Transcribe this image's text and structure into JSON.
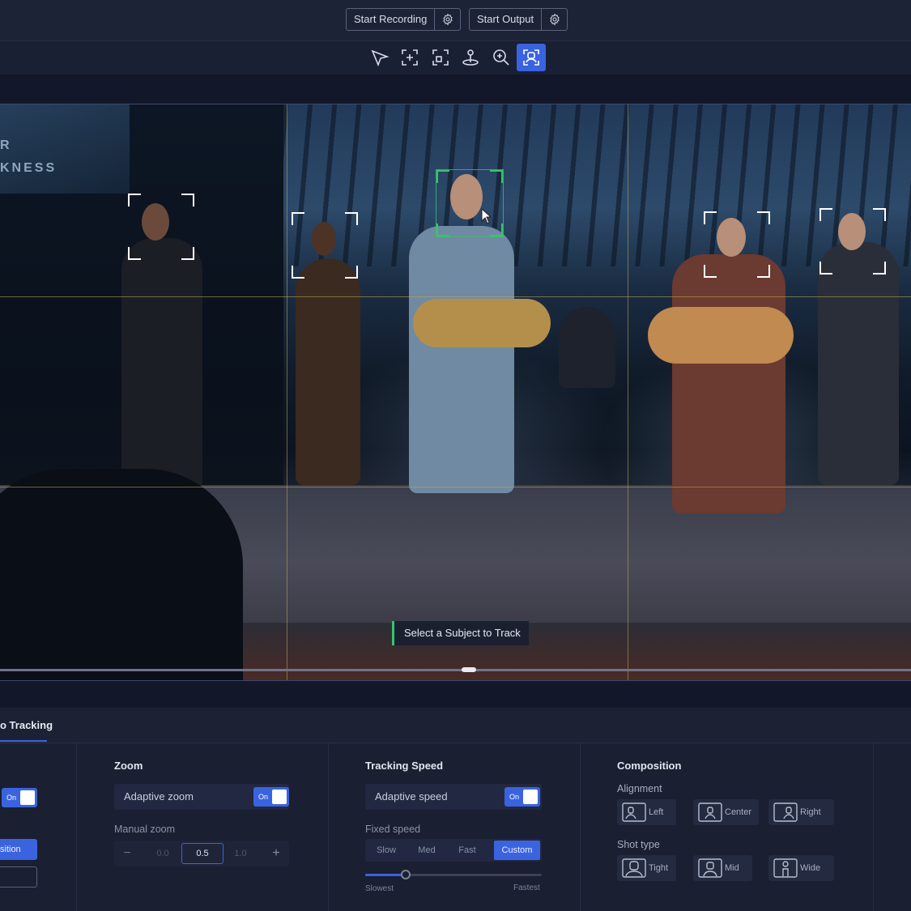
{
  "topbar": {
    "start_recording": "Start Recording",
    "start_output": "Start Output",
    "icons": [
      "gear-icon",
      "gear-icon"
    ]
  },
  "toolbar": {
    "tools": [
      "pointer-tool",
      "add-region-tool",
      "crop-tool",
      "position-pin-tool",
      "zoom-tool",
      "face-tracking-tool"
    ],
    "active_tool": "face-tracking-tool"
  },
  "video": {
    "screen_text_line1": "R",
    "screen_text_line2": "KNESS",
    "tooltip": "Select a Subject to Track"
  },
  "panel": {
    "tab_label": "o Tracking",
    "left_toggle_on": "On",
    "left_button_label": "sition",
    "zoom": {
      "title": "Zoom",
      "adaptive_label": "Adaptive zoom",
      "toggle_on": "On",
      "manual_label": "Manual zoom",
      "minus": "−",
      "plus": "+",
      "val_prev": "0.0",
      "val_current": "0.5",
      "val_next": "1.0"
    },
    "speed": {
      "title": "Tracking Speed",
      "adaptive_label": "Adaptive speed",
      "toggle_on": "On",
      "fixed_label": "Fixed speed",
      "options": [
        "Slow",
        "Med",
        "Fast",
        "Custom"
      ],
      "selected": "Custom",
      "slider_value": 0.23,
      "min_label": "Slowest",
      "max_label": "Fastest"
    },
    "composition": {
      "title": "Composition",
      "alignment_label": "Alignment",
      "alignment_options": [
        "Left",
        "Center",
        "Right"
      ],
      "shot_label": "Shot type",
      "shot_options": [
        "Tight",
        "Mid",
        "Wide"
      ]
    }
  },
  "colors": {
    "accent": "#3a63e0",
    "selected_subject": "#36c46b",
    "background": "#161b2c"
  }
}
